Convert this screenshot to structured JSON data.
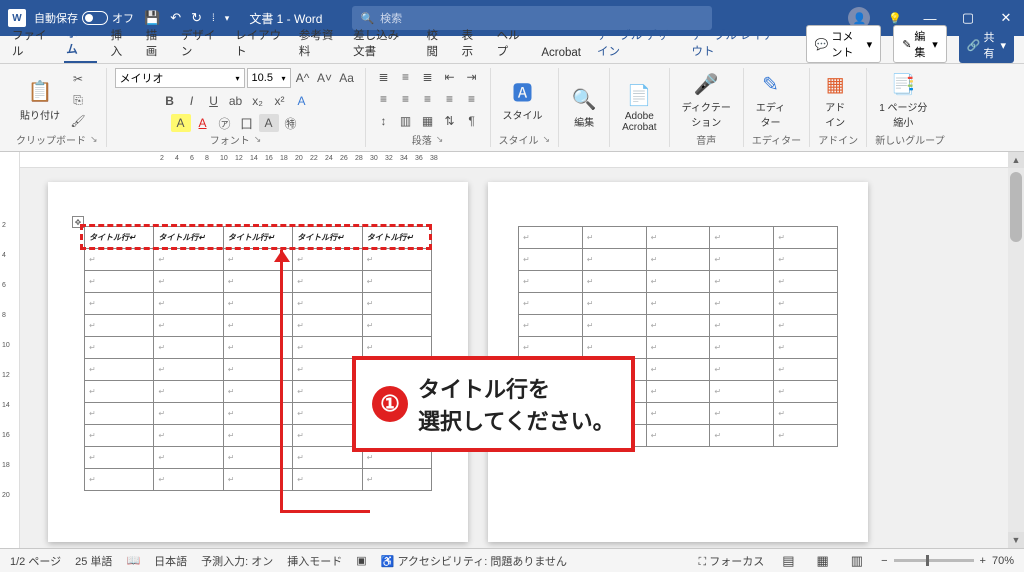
{
  "titlebar": {
    "autosave_label": "自動保存",
    "autosave_state": "オフ",
    "doc_title": "文書 1 - Word",
    "search_placeholder": "検索"
  },
  "tabs": {
    "items": [
      "ファイル",
      "ホーム",
      "挿入",
      "描画",
      "デザイン",
      "レイアウト",
      "参考資料",
      "差し込み文書",
      "校閲",
      "表示",
      "ヘルプ",
      "Acrobat"
    ],
    "context": [
      "テーブル デザイン",
      "テーブル レイアウト"
    ],
    "comment_btn": "コメント",
    "edit_btn": "編集",
    "share_btn": "共有"
  },
  "ribbon": {
    "clipboard": {
      "paste": "貼り付け",
      "label": "クリップボード"
    },
    "font": {
      "name": "メイリオ",
      "size": "10.5",
      "label": "フォント"
    },
    "para": {
      "label": "段落"
    },
    "styles": {
      "btn": "スタイル",
      "label": "スタイル"
    },
    "editing": {
      "btn": "編集"
    },
    "acrobat": {
      "btn": "Adobe\nAcrobat"
    },
    "dictate": {
      "btn": "ディクテー\nション",
      "label": "音声"
    },
    "editor": {
      "btn": "エディ\nター",
      "label": "エディター"
    },
    "addin": {
      "btn": "アド\nイン",
      "label": "アドイン"
    },
    "zoom_group": {
      "btn": "1 ページ分\n縮小",
      "label": "新しいグループ"
    }
  },
  "ruler_h": [
    "2",
    "4",
    "6",
    "8",
    "10",
    "12",
    "14",
    "16",
    "18",
    "20",
    "22",
    "24",
    "26",
    "28",
    "30",
    "32",
    "34",
    "36",
    "38"
  ],
  "ruler_v": [
    "2",
    "4",
    "6",
    "8",
    "10",
    "12",
    "14",
    "16",
    "18",
    "20"
  ],
  "table": {
    "header_cell": "タイトル行",
    "cols": 5,
    "body_rows": 11
  },
  "annotation": {
    "num": "①",
    "line1": "タイトル行を",
    "line2": "選択してください。"
  },
  "statusbar": {
    "page": "1/2 ページ",
    "words": "25 単語",
    "lang": "日本語",
    "predict": "予測入力: オン",
    "insert": "挿入モード",
    "a11y": "アクセシビリティ: 問題ありません",
    "focus": "フォーカス",
    "zoom": "70%"
  }
}
